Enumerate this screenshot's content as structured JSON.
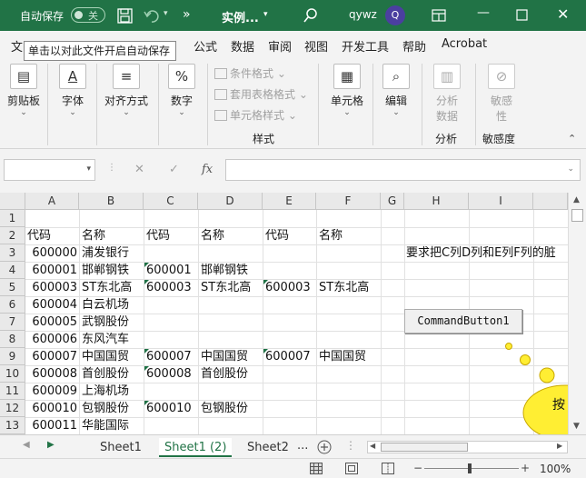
{
  "titlebar": {
    "autosave_label": "自动保存",
    "autosave_state": "关",
    "save_icon": "save-icon",
    "undo_icon": "undo-icon",
    "more": "»",
    "filename": "实例...",
    "search_icon": "search-icon",
    "user": "qywz",
    "avatar_initial": "Q",
    "accent": "#217346"
  },
  "tooltip": "单击以对此文件开启自动保存",
  "tabs": [
    {
      "label": "文"
    },
    {
      "label": "公式"
    },
    {
      "label": "数据"
    },
    {
      "label": "审阅"
    },
    {
      "label": "视图"
    },
    {
      "label": "开发工具"
    },
    {
      "label": "帮助"
    },
    {
      "label": "Acrobat"
    }
  ],
  "ribbon": {
    "clipboard": "剪贴板",
    "font": "字体",
    "align": "对齐方式",
    "number": "数字",
    "number_symbol": "%",
    "font_symbol": "A",
    "cond_format": "条件格式",
    "table_format": "套用表格格式",
    "cell_style": "单元格样式",
    "styles_group": "样式",
    "cells": "单元格",
    "edit": "编辑",
    "analyze": "分析\n数据",
    "analyze_l1": "分析",
    "analyze_l2": "数据",
    "analyze_group": "分析",
    "sens_l1": "敏感",
    "sens_l2": "性",
    "sens_group": "敏感度"
  },
  "formula": {
    "fx": "fx",
    "cancel": "✕",
    "enter": "✓"
  },
  "grid": {
    "columns": [
      "A",
      "B",
      "C",
      "D",
      "E",
      "F",
      "G",
      "H",
      "I"
    ],
    "rows": [
      "1",
      "2",
      "3",
      "4",
      "5",
      "6",
      "7",
      "8",
      "9",
      "10",
      "11",
      "12",
      "13"
    ],
    "r2": {
      "a": "代码",
      "b": "名称",
      "c": "代码",
      "d": "名称",
      "e": "代码",
      "f": "名称"
    },
    "r3": {
      "a": "600000",
      "b": "浦发银行",
      "h": "要求把C列D列和E列F列的脏"
    },
    "r4": {
      "a": "600001",
      "b": "邯郸钢铁",
      "c": "600001",
      "d": "邯郸钢铁"
    },
    "r5": {
      "a": "600003",
      "b": "ST东北高",
      "c": "600003",
      "d": "ST东北高",
      "e": "600003",
      "f": "ST东北高"
    },
    "r6": {
      "a": "600004",
      "b": "白云机场"
    },
    "r7": {
      "a": "600005",
      "b": "武钢股份"
    },
    "r8": {
      "a": "600006",
      "b": "东风汽车"
    },
    "r9": {
      "a": "600007",
      "b": "中国国贸",
      "c": "600007",
      "d": "中国国贸",
      "e": "600007",
      "f": "中国国贸"
    },
    "r10": {
      "a": "600008",
      "b": "首创股份",
      "c": "600008",
      "d": "首创股份"
    },
    "r11": {
      "a": "600009",
      "b": "上海机场"
    },
    "r12": {
      "a": "600010",
      "b": "包钢股份",
      "c": "600010",
      "d": "包钢股份"
    },
    "r13": {
      "a": "600011",
      "b": "华能国际"
    },
    "command_button": "CommandButton1",
    "callout_text": "按"
  },
  "sheets": [
    {
      "label": "Sheet1"
    },
    {
      "label": "Sheet1 (2)"
    },
    {
      "label": "Sheet2"
    }
  ],
  "sheets_more": "...",
  "status": {
    "zoom": "100%",
    "minus": "−",
    "plus": "+"
  }
}
